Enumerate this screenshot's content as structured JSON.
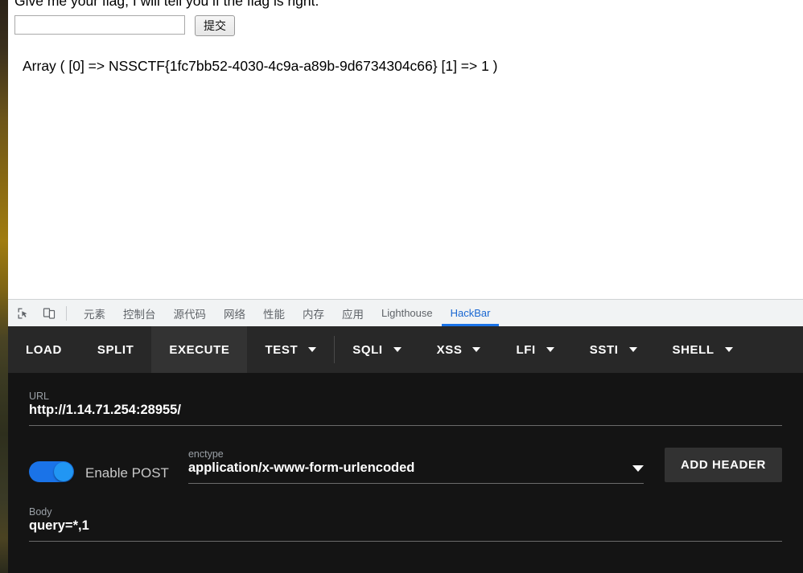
{
  "page": {
    "heading": "Give me your flag, I will tell you if the flag is right.",
    "input_value": "",
    "input_placeholder": "",
    "submit_label": "提交",
    "output": "Array ( [0] => NSSCTF{1fc7bb52-4030-4c9a-a89b-9d6734304c66} [1] => 1 )"
  },
  "devtools": {
    "icons": [
      {
        "name": "inspect-element-icon"
      },
      {
        "name": "device-toolbar-icon"
      }
    ],
    "tabs": [
      {
        "label": "元素",
        "active": false
      },
      {
        "label": "控制台",
        "active": false
      },
      {
        "label": "源代码",
        "active": false
      },
      {
        "label": "网络",
        "active": false
      },
      {
        "label": "性能",
        "active": false
      },
      {
        "label": "内存",
        "active": false
      },
      {
        "label": "应用",
        "active": false
      },
      {
        "label": "Lighthouse",
        "active": false
      },
      {
        "label": "HackBar",
        "active": true
      }
    ],
    "active_tab": "HackBar",
    "accent_color": "#1a73e8"
  },
  "hackbar": {
    "toolbar": [
      {
        "label": "LOAD",
        "caret": false,
        "highlight": false
      },
      {
        "label": "SPLIT",
        "caret": false,
        "highlight": false
      },
      {
        "label": "EXECUTE",
        "caret": false,
        "highlight": true
      },
      {
        "label": "TEST",
        "caret": true,
        "highlight": false
      },
      {
        "label": "SQLI",
        "caret": true,
        "highlight": false
      },
      {
        "label": "XSS",
        "caret": true,
        "highlight": false
      },
      {
        "label": "LFI",
        "caret": true,
        "highlight": false
      },
      {
        "label": "SSTI",
        "caret": true,
        "highlight": false
      },
      {
        "label": "SHELL",
        "caret": true,
        "highlight": false
      }
    ],
    "url": {
      "label": "URL",
      "value": "http://1.14.71.254:28955/"
    },
    "post": {
      "toggle_label": "Enable POST",
      "toggle_on": true
    },
    "enctype": {
      "label": "enctype",
      "value": "application/x-www-form-urlencoded"
    },
    "add_header_label": "ADD HEADER",
    "body": {
      "label": "Body",
      "value": "query=*,1"
    }
  }
}
